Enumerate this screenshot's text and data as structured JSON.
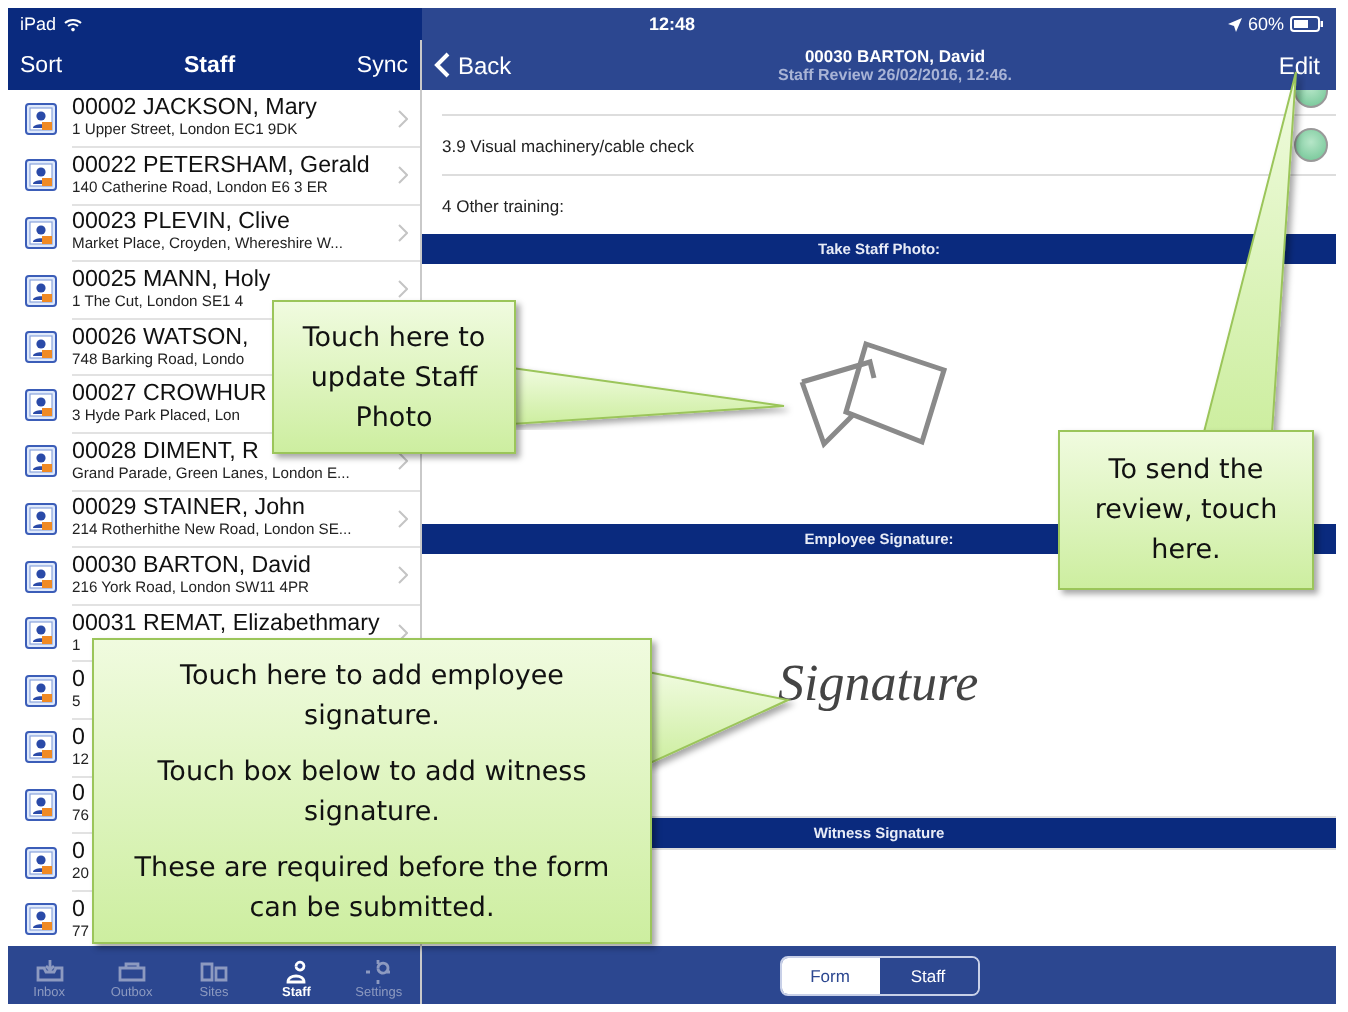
{
  "status_bar": {
    "device": "iPad",
    "time": "12:48",
    "battery": "60%"
  },
  "sidebar": {
    "nav": {
      "left": "Sort",
      "title": "Staff",
      "right": "Sync"
    },
    "items": [
      {
        "name": "00002 JACKSON, Mary",
        "address": "1 Upper Street, London EC1 9DK"
      },
      {
        "name": "00022 PETERSHAM, Gerald",
        "address": "140 Catherine Road, London E6 3 ER"
      },
      {
        "name": "00023 PLEVIN, Clive",
        "address": "Market Place, Croyden, Whereshire W..."
      },
      {
        "name": "00025 MANN, Holy",
        "address": "1 The Cut, London SE1 4"
      },
      {
        "name": "00026 WATSON,",
        "address": "748 Barking Road, Londo"
      },
      {
        "name": "00027 CROWHUR",
        "address": "3 Hyde Park Placed, Lon"
      },
      {
        "name": "00028 DIMENT, R",
        "address": "Grand Parade, Green Lanes, London E..."
      },
      {
        "name": "00029 STAINER, John",
        "address": "214 Rotherhithe New Road, London SE..."
      },
      {
        "name": "00030 BARTON, David",
        "address": "216 York Road, London SW11 4PR"
      },
      {
        "name": "00031 REMAT, Elizabethmary",
        "address": "1"
      },
      {
        "name": "0",
        "address": "5"
      },
      {
        "name": "0",
        "address": "12"
      },
      {
        "name": "0",
        "address": "76"
      },
      {
        "name": "0",
        "address": "20"
      },
      {
        "name": "0",
        "address": "77"
      }
    ]
  },
  "tabs": [
    {
      "label": "Inbox",
      "selected": false
    },
    {
      "label": "Outbox",
      "selected": false
    },
    {
      "label": "Sites",
      "selected": false
    },
    {
      "label": "Staff",
      "selected": true
    },
    {
      "label": "Settings",
      "selected": false
    }
  ],
  "detail": {
    "nav": {
      "back": "Back",
      "title": "00030 BARTON, David",
      "subtitle": "Staff Review 26/02/2016, 12:46.",
      "action": "Edit"
    },
    "sections": [
      {
        "kind": "check",
        "on": true
      },
      {
        "kind": "check",
        "label": "3.9 Visual machinery/cable check",
        "on": true
      },
      {
        "kind": "text",
        "label": "4 Other training:"
      },
      {
        "kind": "bar",
        "label": "Take Staff Photo:"
      },
      {
        "kind": "photo"
      },
      {
        "kind": "bar",
        "label": "Employee Signature:"
      },
      {
        "kind": "signature",
        "text": "Signature"
      },
      {
        "kind": "bar",
        "label": "Witness Signature"
      },
      {
        "kind": "blank"
      }
    ],
    "segments": [
      {
        "label": "Form",
        "selected": true
      },
      {
        "label": "Staff",
        "selected": false
      }
    ]
  },
  "callouts": [
    {
      "paragraphs": [
        "Touch here to update Staff Photo"
      ]
    },
    {
      "paragraphs": [
        "Touch here to add employee signature.",
        "Touch box below to add witness signature.",
        "These are required before the form can be submitted."
      ]
    },
    {
      "paragraphs": [
        "To send the review, touch here."
      ]
    }
  ]
}
